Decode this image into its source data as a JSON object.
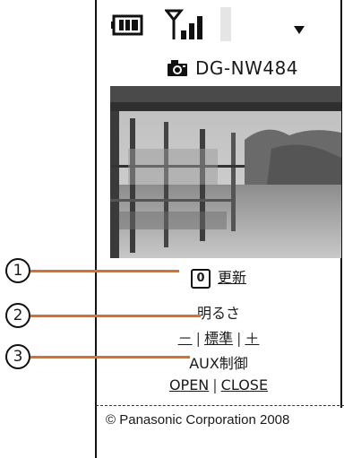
{
  "device": {
    "camera_name": "DG-NW484"
  },
  "controls": {
    "refresh_label": "更新",
    "refresh_key": "0",
    "brightness_title": "明るさ",
    "brightness_minus": "－",
    "brightness_standard": "標準",
    "brightness_plus": "＋",
    "aux_title": "AUX制御",
    "aux_open": "OPEN",
    "aux_close": "CLOSE"
  },
  "footer": {
    "copyright": "© Panasonic Corporation 2008"
  },
  "callouts": {
    "one": "1",
    "two": "2",
    "three": "3"
  },
  "colors": {
    "callout_line": "#e86b1f"
  }
}
